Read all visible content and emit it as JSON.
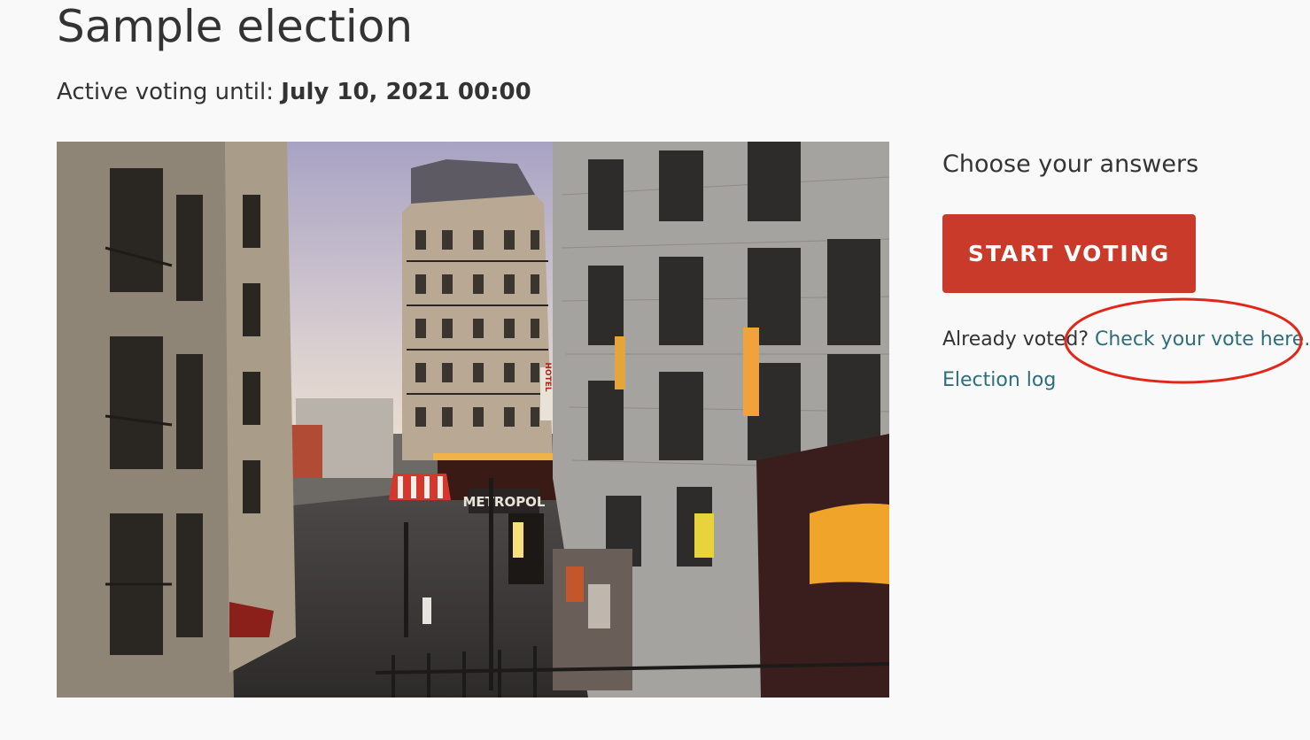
{
  "election": {
    "title": "Sample election",
    "active_label": "Active voting until:",
    "active_until": "July 10, 2021 00:00"
  },
  "sidebar": {
    "choose_heading": "Choose your answers",
    "start_button_label": "START VOTING",
    "already_voted_text": "Already voted?",
    "check_vote_link": "Check your vote here.",
    "election_log_link": "Election log"
  },
  "photo_signs": {
    "hotel": "HOTEL",
    "metropol": "METROPOL"
  },
  "colors": {
    "accent_button": "#c93a2a",
    "link": "#2e6e7c",
    "annotation_circle": "#e0271a",
    "background": "#f9f9f9"
  }
}
